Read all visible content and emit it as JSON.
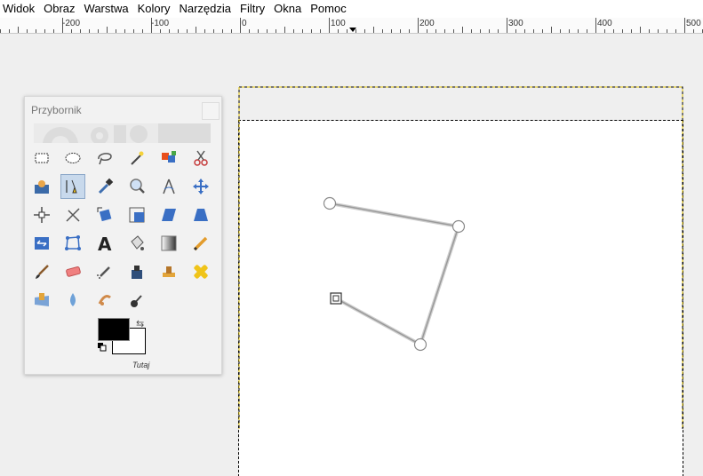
{
  "menu": [
    "Widok",
    "Obraz",
    "Warstwa",
    "Kolory",
    "Narzędzia",
    "Filtry",
    "Okna",
    "Pomoc"
  ],
  "ruler": {
    "labels": [
      "-200",
      "-100",
      "0",
      "100",
      "200",
      "300",
      "400",
      "500"
    ]
  },
  "toolbox": {
    "title": "Przybornik",
    "hint": "Tutaj",
    "foreground_color": "#000000",
    "background_color": "#ffffff",
    "tools": [
      "rect-select-icon",
      "ellipse-select-icon",
      "lasso-icon",
      "magic-wand-icon",
      "color-select-icon",
      "scissors-icon",
      "foreground-select-icon",
      "paths-icon",
      "color-picker-icon",
      "zoom-icon",
      "measure-icon",
      "move-icon",
      "alignment-icon",
      "crop-icon",
      "rotate-icon",
      "scale-icon",
      "shear-icon",
      "perspective-icon",
      "flip-icon",
      "cage-icon",
      "text-icon",
      "bucket-fill-icon",
      "blend-icon",
      "pencil-icon",
      "paintbrush-icon",
      "eraser-icon",
      "airbrush-icon",
      "ink-icon",
      "clone-icon",
      "heal-icon",
      "perspective-clone-icon",
      "blur-icon",
      "smudge-icon",
      "dodge-burn-icon"
    ]
  }
}
